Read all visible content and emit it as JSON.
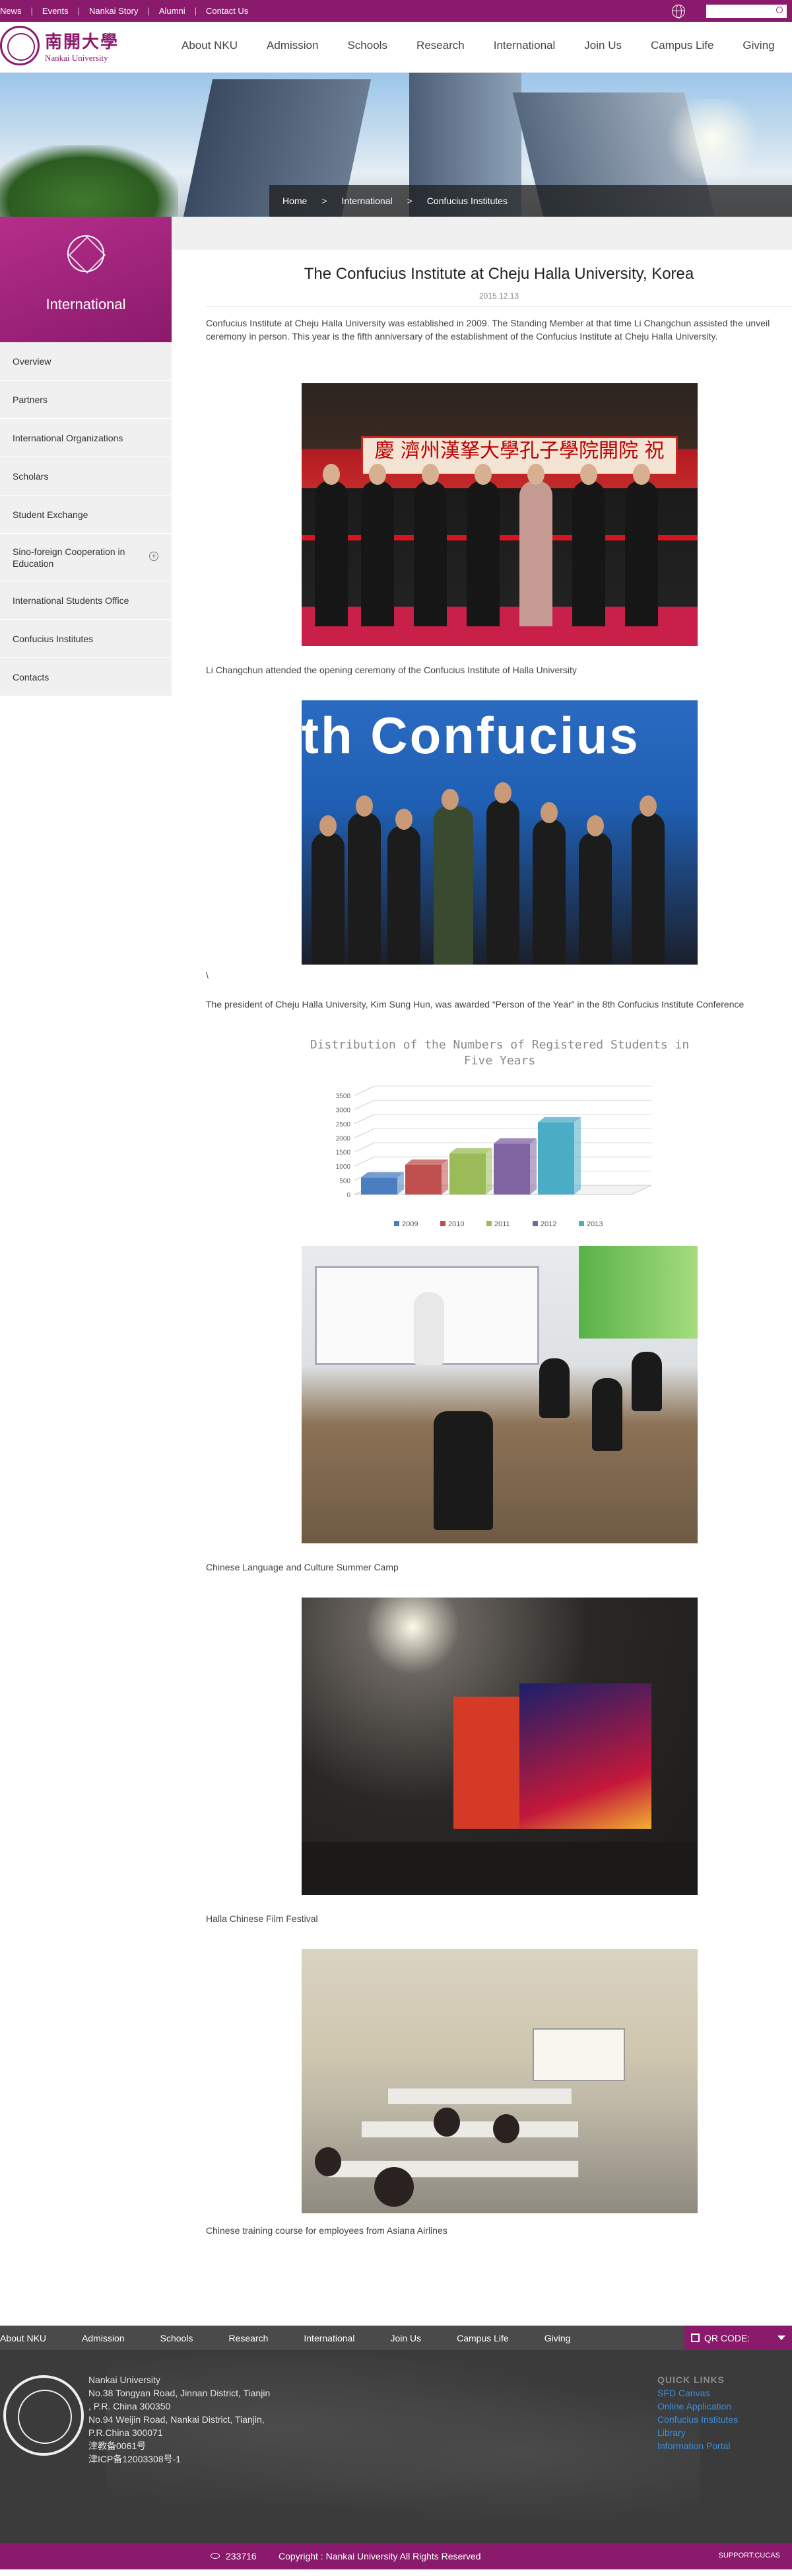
{
  "topbar": {
    "links": [
      "News",
      "Events",
      "Nankai Story",
      "Alumni",
      "Contact Us"
    ],
    "search_placeholder": ""
  },
  "logo": {
    "cn": "南開大學",
    "en": "Nankai University"
  },
  "nav": [
    "About NKU",
    "Admission",
    "Schools",
    "Research",
    "International",
    "Join Us",
    "Campus Life",
    "Giving"
  ],
  "breadcrumb": [
    "Home",
    ">",
    "International",
    ">",
    "Confucius Institutes"
  ],
  "sidebar": {
    "title": "International",
    "items": [
      {
        "label": "Overview"
      },
      {
        "label": "Partners"
      },
      {
        "label": "International Organizations"
      },
      {
        "label": "Scholars"
      },
      {
        "label": "Student Exchange"
      },
      {
        "label": "Sino-foreign Cooperation in Education"
      },
      {
        "label": "International Students Office"
      },
      {
        "label": "Confucius Institutes"
      },
      {
        "label": "Contacts"
      }
    ]
  },
  "article": {
    "title": "The Confucius Institute at Cheju Halla University, Korea",
    "date": "2015.12.13",
    "intro": "Confucius Institute at Cheju Halla University was established in 2009. The Standing Member at that time Li Changchun assisted the unveil ceremony in person. This year is the fifth anniversary of the establishment of the Confucius Institute at Cheju Halla University.",
    "photo1_sign": "慶  濟州漢拏大學孔子學院開院  祝",
    "caption1": "Li Changchun attended the opening ceremony of the Confucius Institute of Halla University",
    "photo2_text": "th Confucius",
    "backslash": "\\",
    "caption2": "The president of Cheju Halla University, Kim Sung Hun, was awarded “Person of the Year” in the 8th Confucius Institute Conference",
    "caption3": "Chinese Language and Culture Summer Camp",
    "caption4": "Halla Chinese Film Festival",
    "caption5": "Chinese training course for employees from Asiana Airlines"
  },
  "chart_data": {
    "type": "bar",
    "title": "Distribution of the Numbers of Registered Students in Five Years",
    "categories": [
      "2009",
      "2010",
      "2011",
      "2012",
      "2013"
    ],
    "values": [
      600,
      1050,
      1450,
      1800,
      2550
    ],
    "colors": [
      "#4a7ec0",
      "#c0504d",
      "#9bbb59",
      "#8064a2",
      "#4bacc6"
    ],
    "yticks": [
      "3500",
      "3000",
      "2500",
      "2000",
      "1500",
      "1000",
      "500",
      "0"
    ],
    "ylim": [
      0,
      3500
    ],
    "legend": "bottom",
    "three_d": true
  },
  "footer_nav": [
    "About NKU",
    "Admission",
    "Schools",
    "Research",
    "International",
    "Join Us",
    "Campus Life",
    "Giving"
  ],
  "qr_label": "QR CODE:",
  "footer": {
    "address": [
      "Nankai University",
      "No.38 Tongyan Road, Jinnan District, Tianjin",
      ", P.R. China 300350",
      "No.94 Weijin Road,  Nankai District, Tianjin,",
      "P.R.China  300071",
      "津教备0061号",
      "津ICP备12003308号-1"
    ],
    "quick_links_title": "QUICK LINKS",
    "quick_links": [
      "SFD Canvas",
      "Online Application",
      "Confucius Institutes",
      "Library",
      "Information Portal"
    ]
  },
  "bottom": {
    "visits": "233716",
    "copyright": "Copyright : Nankai University All Rights Reserved",
    "support": "SUPPORT:CUCAS"
  }
}
